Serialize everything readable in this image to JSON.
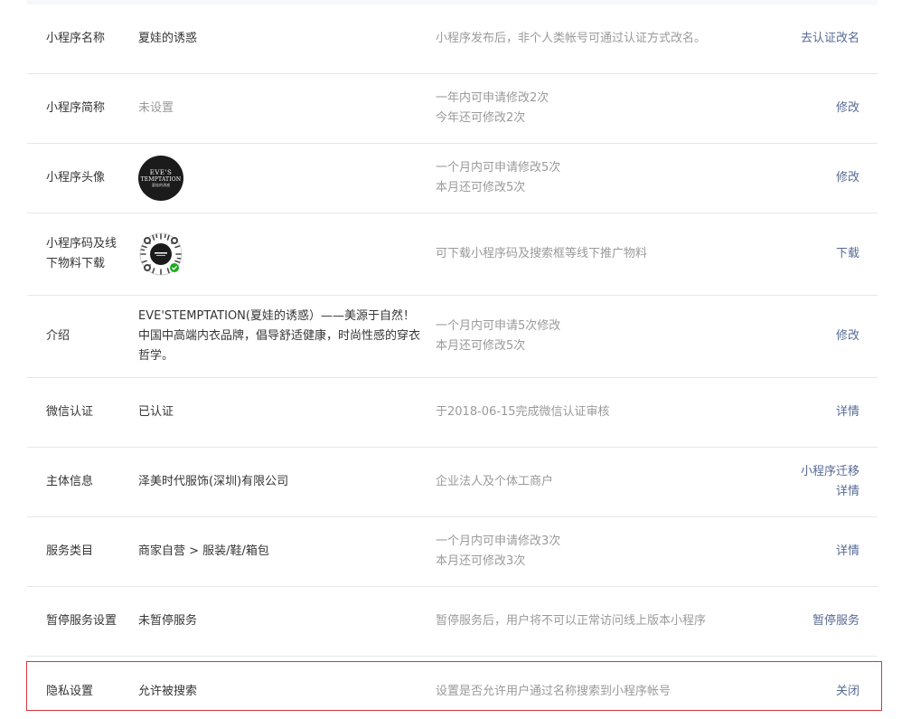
{
  "rows": [
    {
      "id": "name",
      "label": "小程序名称",
      "value": "夏娃的诱惑",
      "desc": [
        "小程序发布后，非个人类帐号可通过认证方式改名。"
      ],
      "actions": [
        "去认证改名"
      ]
    },
    {
      "id": "short-name",
      "label": "小程序简称",
      "value": "未设置",
      "desc": [
        "一年内可申请修改2次",
        "今年还可修改2次"
      ],
      "actions": [
        "修改"
      ]
    },
    {
      "id": "avatar",
      "label": "小程序头像",
      "avatar": {
        "line1": "EVE'S",
        "line2": "TEMPTATION",
        "line3": "夏娃的诱惑"
      },
      "desc": [
        "一个月内可申请修改5次",
        "本月还可修改5次"
      ],
      "actions": [
        "修改"
      ]
    },
    {
      "id": "qrcode",
      "label": "小程序码及线下物料下载",
      "desc": [
        "可下载小程序码及搜索框等线下推广物料"
      ],
      "actions": [
        "下载"
      ]
    },
    {
      "id": "intro",
      "label": "介绍",
      "value": "EVE'STEMPTATION(夏娃的诱惑）——美源于自然！中国中高端内衣品牌，倡导舒适健康，时尚性感的穿衣哲学。",
      "desc": [
        "一个月内可申请5次修改",
        "本月还可修改5次"
      ],
      "actions": [
        "修改"
      ]
    },
    {
      "id": "wechat-verify",
      "label": "微信认证",
      "value": "已认证",
      "desc": [
        "于2018-06-15完成微信认证审核"
      ],
      "actions": [
        "详情"
      ]
    },
    {
      "id": "entity",
      "label": "主体信息",
      "value": "泽美时代服饰(深圳)有限公司",
      "desc": [
        "企业法人及个体工商户"
      ],
      "actions": [
        "小程序迁移",
        "详情"
      ]
    },
    {
      "id": "category",
      "label": "服务类目",
      "value": "商家自营 > 服装/鞋/箱包",
      "desc": [
        "一个月内可申请修改3次",
        "本月还可修改3次"
      ],
      "actions": [
        "详情"
      ]
    },
    {
      "id": "pause",
      "label": "暂停服务设置",
      "value": "未暂停服务",
      "desc": [
        "暂停服务后，用户将不可以正常访问线上版本小程序"
      ],
      "actions": [
        "暂停服务"
      ]
    },
    {
      "id": "privacy",
      "label": "隐私设置",
      "value": "允许被搜索",
      "desc": [
        "设置是否允许用户通过名称搜索到小程序帐号"
      ],
      "actions": [
        "关闭"
      ]
    }
  ],
  "colors": {
    "link": "#576b95",
    "muted": "#9a9a9a",
    "text": "#353535",
    "divider": "#e7e7eb",
    "highlight": "#d9363e",
    "wechat_green": "#1aad19"
  }
}
